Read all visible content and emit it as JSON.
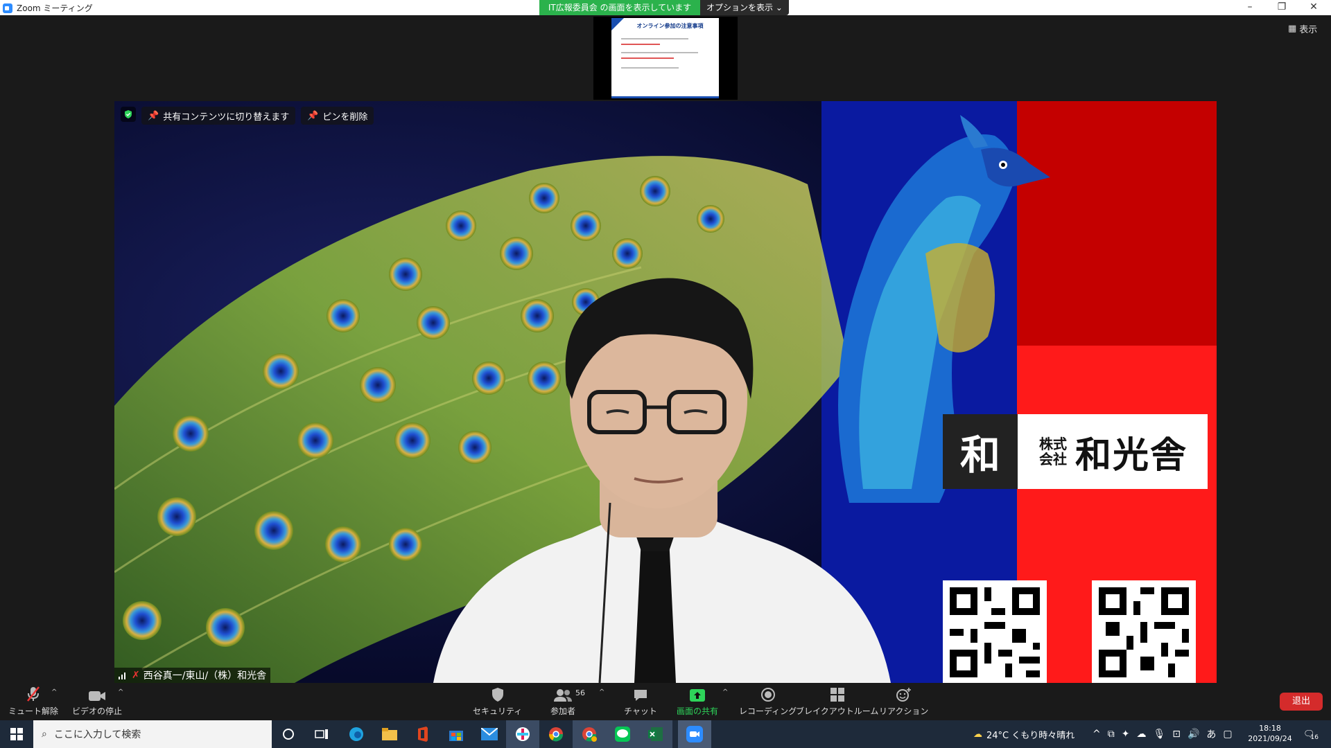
{
  "window": {
    "title": "Zoom ミーティング",
    "share_banner": "IT広報委員会 の画面を表示しています",
    "options_label": "オプションを表示",
    "view_label": "表示"
  },
  "shared_slide": {
    "title": "オンライン参加の注意事項"
  },
  "video": {
    "pin_switch_label": "共有コンテンツに切り替えます",
    "unpin_label": "ピンを削除",
    "participant_name": "西谷真一/東山/（株）和光舎",
    "logo_mark": "和",
    "logo_company_type": "株式会社",
    "logo_company_name": "和光舎"
  },
  "toolbar": {
    "mute_label": "ミュート解除",
    "video_label": "ビデオの停止",
    "security_label": "セキュリティ",
    "participants_label": "参加者",
    "participants_count": "56",
    "chat_label": "チャット",
    "share_label": "画面の共有",
    "record_label": "レコーディング",
    "breakout_label": "ブレイクアウトルーム",
    "reaction_label": "リアクション",
    "leave_label": "退出"
  },
  "taskbar": {
    "search_placeholder": "ここに入力して検索",
    "weather": "24°C くもり時々晴れ",
    "ime": "あ",
    "time": "18:18",
    "date": "2021/09/24",
    "notifications": "16"
  },
  "colors": {
    "share_green": "#2bb24c",
    "leave_red": "#d42b2b",
    "zoom_blue": "#2d8cff",
    "toolbar_bg": "#1a1a1a"
  }
}
